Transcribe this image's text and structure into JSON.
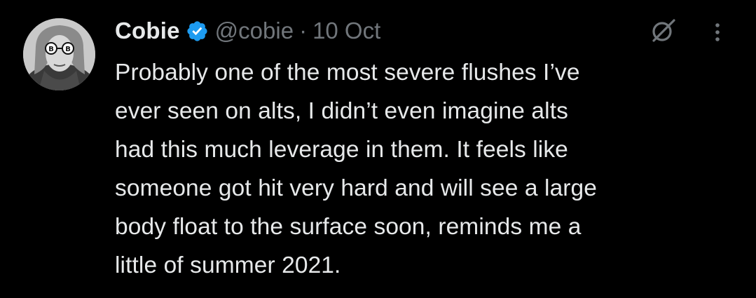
{
  "tweet": {
    "author_name": "Cobie",
    "verified": true,
    "handle": "@cobie",
    "separator": "·",
    "timestamp": "10 Oct",
    "text": "Probably one of the most severe flushes I’ve\never seen on alts, I didn’t even imagine alts\nhad this much leverage in them. It feels like\nsomeone got hit very hard and will see a large\nbody float to the surface soon, reminds me a\nlittle of summer 2021."
  },
  "icons": {
    "verified": "verified-badge-icon",
    "grok": "grok-icon",
    "more": "more-options-icon"
  },
  "colors": {
    "background": "#000000",
    "text_primary": "#e7e9ea",
    "text_secondary": "#71767b",
    "verified_blue": "#1d9bf0"
  }
}
